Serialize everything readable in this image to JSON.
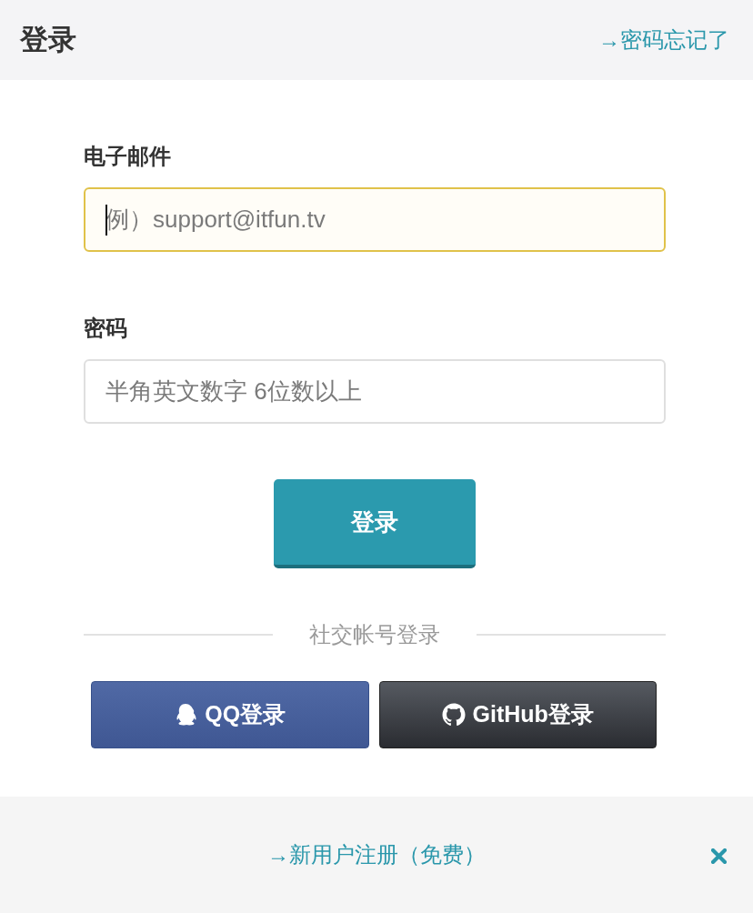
{
  "header": {
    "title": "登录",
    "link": "→密码忘记了"
  },
  "form": {
    "fields": [
      {
        "label": "电子邮件",
        "placeholder": "例）support@itfun.tv",
        "focused": true
      },
      {
        "label": "密码",
        "placeholder": "半角英文数字 6位数以上",
        "focused": false
      }
    ],
    "submit": "登录"
  },
  "social": {
    "heading": "社交帐号登录",
    "buttons": [
      {
        "kind": "qq",
        "label": "QQ登录"
      },
      {
        "kind": "github",
        "label": "GitHub登录"
      }
    ]
  },
  "footer": {
    "link": "→新用户注册（免费）"
  }
}
